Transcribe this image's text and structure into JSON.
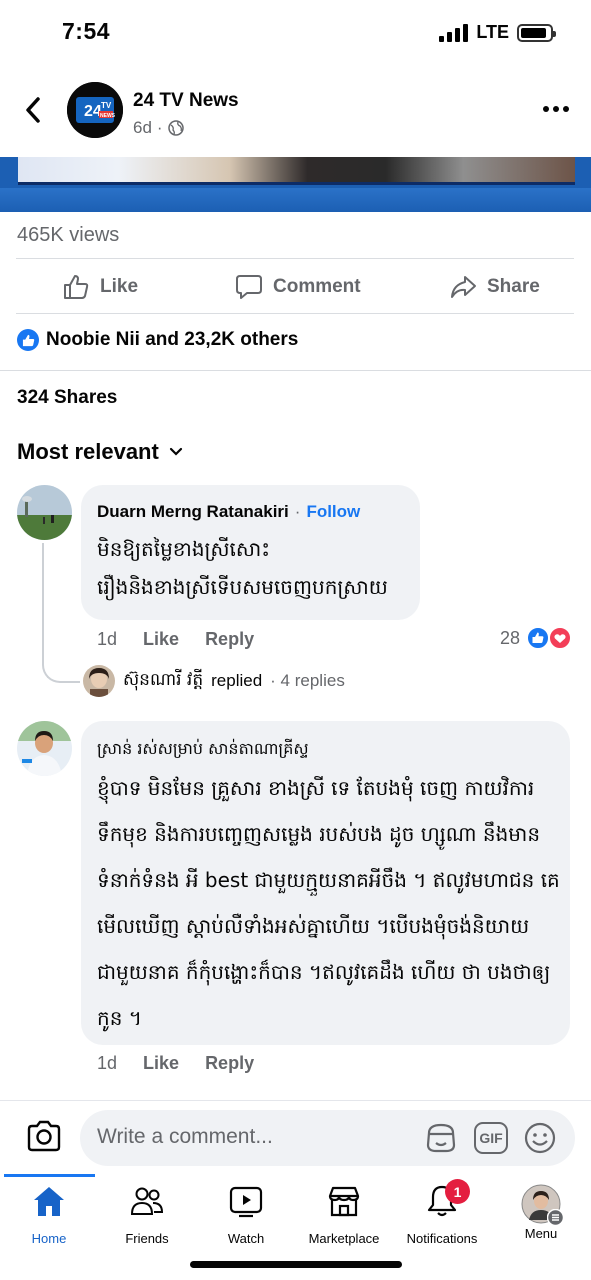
{
  "status_bar": {
    "time": "7:54",
    "network": "LTE"
  },
  "header": {
    "page_name": "24 TV News",
    "age": "6d",
    "avatar_text": "24TV",
    "avatar_subtext": "NEWS"
  },
  "post": {
    "views": "465K views",
    "actions": {
      "like": "Like",
      "comment": "Comment",
      "share": "Share"
    },
    "reactions": "Noobie Nii and 23,2K others",
    "shares": "324 Shares",
    "sort_label": "Most relevant"
  },
  "comments": [
    {
      "author": "Duarn Merng Ratanakiri",
      "follow": "Follow",
      "lines": [
        "មិនឱ្យតម្លៃខាងស្រីសោះ",
        "រឿងនិងខាងស្រីទើបសមចេញបកស្រាយ"
      ],
      "time": "1d",
      "like": "Like",
      "reply": "Reply",
      "reaction_count": "28",
      "reply_preview": {
        "author": "ស៊ុនណារី វត្តី",
        "action": "replied",
        "count": "· 4 replies"
      }
    },
    {
      "author": "ស្រាន់ រស់សម្រាប់ សាន់តាណាគ្រីស្ទ",
      "lines": [
        "ខ្ញុំបាទ មិនមែន គ្រួសារ ខាងស្រី ទេ តែបងមុំ ចេញ កាយវិការ",
        "ទឹកមុខ និងការបញ្ចេញសម្លេង របស់បង ដូច ហ្សូណា នឹងមាន",
        "ទំនាក់ទំនង អី best ជាមួយក្មួយនាគអីចឹង ។ ឥលូវមហាជន គេ",
        "មើលឃើញ ស្តាប់លឺទាំងអស់គ្នាហើយ ។បើបងមុំចង់និយាយ",
        "ជាមួយនាគ ក៏កុំបង្ហោះក៏បាន ។ឥលូវគេដឹង ហើយ ថា បងថាឲ្យ",
        "កូន ។"
      ],
      "time": "1d",
      "like": "Like",
      "reply": "Reply"
    }
  ],
  "composer": {
    "placeholder": "Write a comment...",
    "gif": "GIF"
  },
  "tabs": [
    {
      "label": "Home"
    },
    {
      "label": "Friends"
    },
    {
      "label": "Watch"
    },
    {
      "label": "Marketplace"
    },
    {
      "label": "Notifications",
      "badge": "1"
    },
    {
      "label": "Menu"
    }
  ],
  "colors": {
    "accent": "#1877f2",
    "badge": "#e41e3f",
    "love": "#f33e58"
  }
}
